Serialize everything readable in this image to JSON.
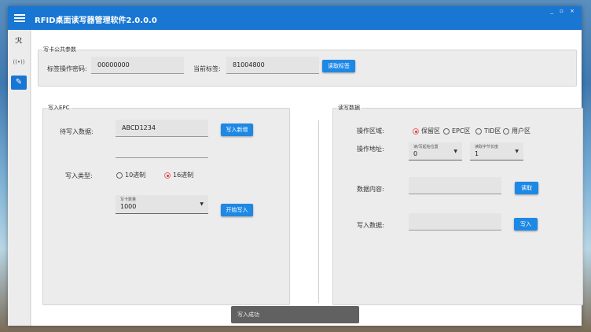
{
  "app": {
    "title": "RFID桌面读写器管理软件2.0.0.0",
    "window_controls": "_ ▫ ×"
  },
  "sidebar": {
    "items": [
      {
        "icon": "logo-icon",
        "glyph": "ℛ"
      },
      {
        "icon": "antenna-icon",
        "glyph": "((•))"
      },
      {
        "icon": "pencil-icon",
        "glyph": "✎",
        "active": true
      }
    ]
  },
  "common": {
    "legend": "写卡公共参数",
    "password_label": "标签操作密码:",
    "password_value": "00000000",
    "tag_label": "当前标签:",
    "tag_value": "81004800",
    "read_tag_button": "读取标签"
  },
  "write_epc": {
    "legend": "写入EPC",
    "data_label": "待写入数据:",
    "data_value": "ABCD1234",
    "write_new_button": "写入新增",
    "type_label": "写入类型:",
    "type_options": [
      "10进制",
      "16进制"
    ],
    "type_selected": "16进制",
    "count_hint": "写卡数量",
    "count_value": "1000",
    "start_button": "开始写入"
  },
  "rw_data": {
    "legend": "读写数据",
    "area_label": "操作区域:",
    "area_options": [
      "保留区",
      "EPC区",
      "TID区",
      "用户区"
    ],
    "area_selected": "保留区",
    "addr_label": "操作地址:",
    "start_hint": "读/写起始位置",
    "start_value": "0",
    "len_hint": "读取字节长度",
    "len_value": "1",
    "content_label": "数据内容:",
    "read_button": "读取",
    "write_label": "写入数据:",
    "write_button": "写入"
  },
  "toast": {
    "message": "写入成功"
  },
  "colors": {
    "accent": "#1976d2",
    "button": "#1e88e5",
    "radio_on": "#e53935"
  }
}
